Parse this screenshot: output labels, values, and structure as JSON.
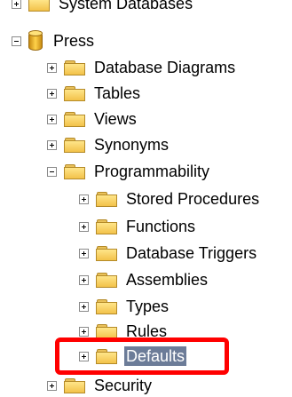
{
  "tree": {
    "items": [
      {
        "label": "System Databases",
        "expander": "plus",
        "icon": "folder-icon"
      },
      {
        "label": "Press",
        "expander": "minus",
        "icon": "database-icon"
      },
      {
        "label": "Database Diagrams",
        "expander": "plus",
        "icon": "folder-icon"
      },
      {
        "label": "Tables",
        "expander": "plus",
        "icon": "folder-icon"
      },
      {
        "label": "Views",
        "expander": "plus",
        "icon": "folder-icon"
      },
      {
        "label": "Synonyms",
        "expander": "plus",
        "icon": "folder-icon"
      },
      {
        "label": "Programmability",
        "expander": "minus",
        "icon": "folder-icon"
      },
      {
        "label": "Stored Procedures",
        "expander": "plus",
        "icon": "folder-icon"
      },
      {
        "label": "Functions",
        "expander": "plus",
        "icon": "folder-icon"
      },
      {
        "label": "Database Triggers",
        "expander": "plus",
        "icon": "folder-icon"
      },
      {
        "label": "Assemblies",
        "expander": "plus",
        "icon": "folder-icon"
      },
      {
        "label": "Types",
        "expander": "plus",
        "icon": "folder-icon"
      },
      {
        "label": "Rules",
        "expander": "plus",
        "icon": "folder-icon"
      },
      {
        "label": "Defaults",
        "expander": "plus",
        "icon": "folder-icon",
        "selected": true
      },
      {
        "label": "Security",
        "expander": "plus",
        "icon": "folder-icon"
      }
    ]
  },
  "colors": {
    "selection": "#6c7c98",
    "highlight_box": "#ff0000",
    "folder": "#f3c24a"
  }
}
